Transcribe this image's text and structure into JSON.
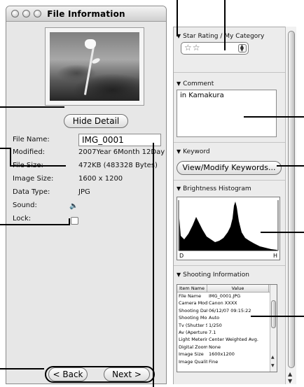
{
  "window": {
    "title": "File Information"
  },
  "left": {
    "hide_detail_label": "Hide Detail",
    "fields": [
      {
        "label": "File Name:",
        "value": "IMG_0001"
      },
      {
        "label": "Modified:",
        "value": "2007Year 6Month 12Day"
      },
      {
        "label": "File Size:",
        "value": "472KB (483328 Bytes)"
      },
      {
        "label": "Image Size:",
        "value": "1600 x 1200"
      },
      {
        "label": "Data Type:",
        "value": "JPG"
      },
      {
        "label": "Sound:",
        "value": ""
      },
      {
        "label": "Lock:",
        "value": ""
      }
    ],
    "back_label": "< Back",
    "next_label": "Next >"
  },
  "right": {
    "star_section_title": "Star Rating / My Category",
    "star_value": "☆☆",
    "comment_title": "Comment",
    "comment_text": "in Kamakura",
    "keyword_title": "Keyword",
    "keyword_button": "View/Modify Keywords...",
    "histogram_title": "Brightness Histogram",
    "hist_left_label": "D",
    "hist_right_label": "H",
    "shooting_title": "Shooting Information",
    "table_headers": [
      "Item Name",
      "Value"
    ],
    "table_rows": [
      [
        "File Name",
        "IMG_0001.JPG"
      ],
      [
        "Camera Mod",
        "Canon XXXX"
      ],
      [
        "Shooting Dat",
        "06/12/07 09:15:22"
      ],
      [
        "Shooting Mo",
        "Auto"
      ],
      [
        "Tv (Shutter S",
        "1/250"
      ],
      [
        "Av (Aperture",
        "7.1"
      ],
      [
        "Light Meterir",
        "Center Weighted Avg."
      ],
      [
        "Digital Zoom",
        "None"
      ],
      [
        "Image Size",
        "1600x1200"
      ],
      [
        "Image Qualit",
        "Fine"
      ]
    ]
  },
  "icons": {
    "close": "traffic-light-button",
    "sound": "speaker-icon",
    "disclosure": "triangle-down-icon"
  }
}
